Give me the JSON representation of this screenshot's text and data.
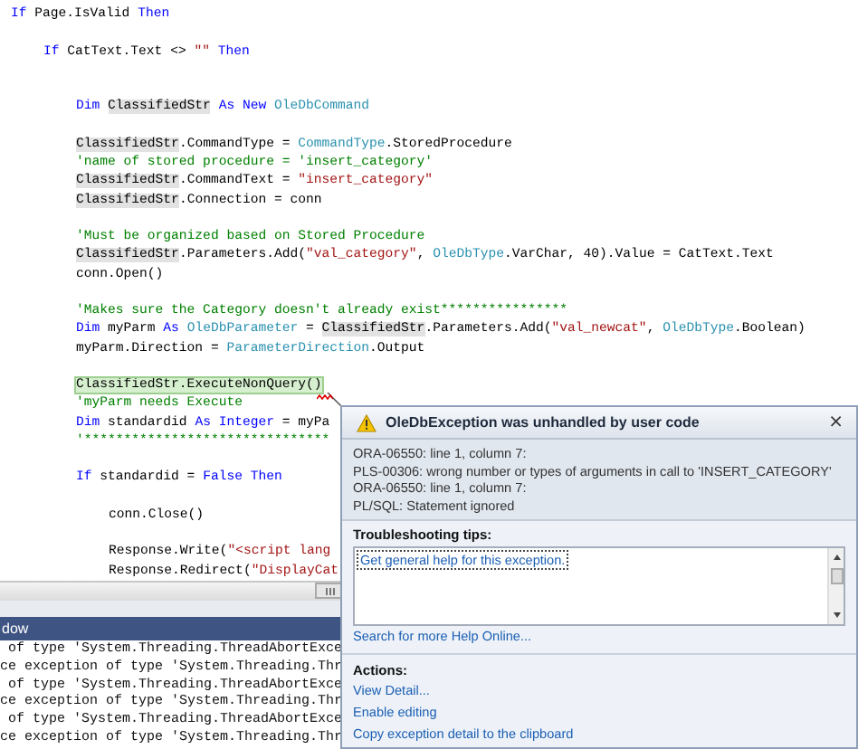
{
  "editor": {
    "lines": [
      {
        "kind": "code",
        "tokens": [
          {
            "kind": "keyword",
            "text": "If"
          },
          {
            "kind": "plain",
            "text": " Page.IsValid "
          },
          {
            "kind": "keyword",
            "text": "Then"
          }
        ],
        "children": [
          {
            "kind": "blank"
          },
          {
            "kind": "code",
            "tokens": [
              {
                "kind": "keyword",
                "text": "If"
              },
              {
                "kind": "plain",
                "text": " CatText.Text <> "
              },
              {
                "kind": "string",
                "text": "\"\""
              },
              {
                "kind": "keyword",
                "text": " Then"
              }
            ],
            "children": [
              {
                "kind": "blank"
              },
              {
                "kind": "blank"
              },
              {
                "kind": "code",
                "tokens": [
                  {
                    "kind": "keyword",
                    "text": "Dim "
                  },
                  {
                    "kind": "reference",
                    "text": "ClassifiedStr"
                  },
                  {
                    "kind": "keyword",
                    "text": " As New "
                  },
                  {
                    "kind": "type",
                    "text": "OleDbCommand"
                  }
                ]
              },
              {
                "kind": "blank"
              },
              {
                "kind": "code",
                "tokens": [
                  {
                    "kind": "reference",
                    "text": "ClassifiedStr"
                  },
                  {
                    "kind": "plain",
                    "text": ".CommandType = "
                  },
                  {
                    "kind": "type",
                    "text": "CommandType"
                  },
                  {
                    "kind": "plain",
                    "text": ".StoredProcedure"
                  }
                ]
              },
              {
                "kind": "code",
                "tokens": [
                  {
                    "kind": "comment",
                    "text": "'name of stored procedure = 'insert_category'"
                  }
                ]
              },
              {
                "kind": "code",
                "tokens": [
                  {
                    "kind": "reference",
                    "text": "ClassifiedStr"
                  },
                  {
                    "kind": "plain",
                    "text": ".CommandText = "
                  },
                  {
                    "kind": "string",
                    "text": "\"insert_category\""
                  }
                ]
              },
              {
                "kind": "code",
                "tokens": [
                  {
                    "kind": "reference",
                    "text": "ClassifiedStr"
                  },
                  {
                    "kind": "plain",
                    "text": ".Connection = conn"
                  }
                ]
              },
              {
                "kind": "blank"
              },
              {
                "kind": "code",
                "tokens": [
                  {
                    "kind": "comment",
                    "text": "'Must be organized based on Stored Procedure"
                  }
                ]
              },
              {
                "kind": "code",
                "tokens": [
                  {
                    "kind": "reference",
                    "text": "ClassifiedStr"
                  },
                  {
                    "kind": "plain",
                    "text": ".Parameters.Add("
                  },
                  {
                    "kind": "string",
                    "text": "\"val_category\""
                  },
                  {
                    "kind": "plain",
                    "text": ", "
                  },
                  {
                    "kind": "type",
                    "text": "OleDbType"
                  },
                  {
                    "kind": "plain",
                    "text": ".VarChar, 40).Value = CatText.Text"
                  }
                ]
              },
              {
                "kind": "code",
                "tokens": [
                  {
                    "kind": "plain",
                    "text": "conn.Open()"
                  }
                ]
              },
              {
                "kind": "blank"
              },
              {
                "kind": "code",
                "tokens": [
                  {
                    "kind": "comment",
                    "text": "'Makes sure the Category doesn't already exist****************"
                  }
                ]
              },
              {
                "kind": "code",
                "tokens": [
                  {
                    "kind": "keyword",
                    "text": "Dim"
                  },
                  {
                    "kind": "plain",
                    "text": " myParm "
                  },
                  {
                    "kind": "keyword",
                    "text": "As "
                  },
                  {
                    "kind": "type",
                    "text": "OleDbParameter"
                  },
                  {
                    "kind": "plain",
                    "text": " = "
                  },
                  {
                    "kind": "reference",
                    "text": "ClassifiedStr"
                  },
                  {
                    "kind": "plain",
                    "text": ".Parameters.Add("
                  },
                  {
                    "kind": "string",
                    "text": "\"val_newcat\""
                  },
                  {
                    "kind": "plain",
                    "text": ", "
                  },
                  {
                    "kind": "type",
                    "text": "OleDbType"
                  },
                  {
                    "kind": "plain",
                    "text": ".Boolean)"
                  }
                ]
              },
              {
                "kind": "code",
                "tokens": [
                  {
                    "kind": "plain",
                    "text": "myParm.Direction = "
                  },
                  {
                    "kind": "type",
                    "text": "ParameterDirection"
                  },
                  {
                    "kind": "plain",
                    "text": ".Output"
                  }
                ]
              },
              {
                "kind": "blank"
              },
              {
                "kind": "code",
                "tokens": [
                  {
                    "kind": "current",
                    "text": "ClassifiedStr.ExecuteNonQuery()"
                  }
                ]
              },
              {
                "kind": "code",
                "tokens": [
                  {
                    "kind": "comment",
                    "text": "'myParm needs Execute"
                  }
                ]
              },
              {
                "kind": "code",
                "tokens": [
                  {
                    "kind": "keyword",
                    "text": "Dim"
                  },
                  {
                    "kind": "plain",
                    "text": " standardid "
                  },
                  {
                    "kind": "keyword",
                    "text": "As Integer"
                  },
                  {
                    "kind": "plain",
                    "text": " = myPa"
                  }
                ]
              },
              {
                "kind": "code",
                "tokens": [
                  {
                    "kind": "comment",
                    "text": "'*******************************"
                  }
                ]
              },
              {
                "kind": "blank"
              },
              {
                "kind": "code",
                "tokens": [
                  {
                    "kind": "keyword",
                    "text": "If"
                  },
                  {
                    "kind": "plain",
                    "text": " standardid = "
                  },
                  {
                    "kind": "keyword",
                    "text": "False Then"
                  }
                ],
                "children": [
                  {
                    "kind": "blank"
                  },
                  {
                    "kind": "code",
                    "tokens": [
                      {
                        "kind": "plain",
                        "text": "conn.Close()"
                      }
                    ]
                  },
                  {
                    "kind": "blank"
                  },
                  {
                    "kind": "code",
                    "tokens": [
                      {
                        "kind": "plain",
                        "text": "Response.Write("
                      },
                      {
                        "kind": "string",
                        "text": "\"<script lang"
                      }
                    ]
                  },
                  {
                    "kind": "code",
                    "tokens": [
                      {
                        "kind": "plain",
                        "text": "Response.Redirect("
                      },
                      {
                        "kind": "string",
                        "text": "\"DisplayCat"
                      }
                    ]
                  }
                ]
              }
            ]
          }
        ]
      }
    ]
  },
  "output_pane": {
    "title": "dow",
    "lines": [
      " of type 'System.Threading.ThreadAbortExce",
      "ce exception of type 'System.Threading.Thr",
      " of type 'System.Threading.ThreadAbortExce",
      "ce exception of type 'System.Threading.Thr",
      " of type 'System.Threading.ThreadAbortExce",
      "ce exception of type 'System.Threading.Thr"
    ]
  },
  "exception_dialog": {
    "title": "OleDbException was unhandled by user code",
    "close": "×",
    "message": [
      "ORA-06550: line 1, column 7:",
      "PLS-00306: wrong number or types of arguments in call to 'INSERT_CATEGORY'",
      "ORA-06550: line 1, column 7:",
      "PL/SQL: Statement ignored"
    ],
    "tips_heading": "Troubleshooting tips:",
    "tips": [
      {
        "label": "Get general help for this exception.",
        "focused": true
      }
    ],
    "help_link": "Search for more Help Online...",
    "actions_heading": "Actions:",
    "actions": [
      "View Detail...",
      "Enable editing",
      "Copy exception detail to the clipboard"
    ]
  }
}
